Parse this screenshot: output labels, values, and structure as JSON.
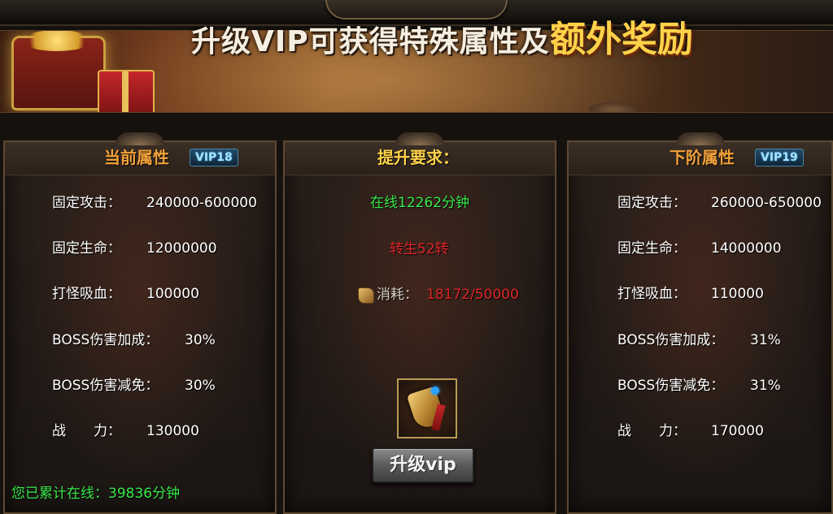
{
  "banner": {
    "title": "升级VIP可获得特殊属性及",
    "highlight": "额外奖励"
  },
  "current": {
    "title": "当前属性",
    "vip": "VIP18",
    "stats": [
      {
        "label": "固定攻击：",
        "value": "240000-600000"
      },
      {
        "label": "固定生命：",
        "value": "12000000"
      },
      {
        "label": "打怪吸血：",
        "value": "100000"
      },
      {
        "label": "BOSS伤害加成：",
        "value": "30%"
      },
      {
        "label": "BOSS伤害减免：",
        "value": "30%"
      },
      {
        "label": "战　　力：",
        "value": "130000"
      }
    ]
  },
  "requirement": {
    "title": "提升要求：",
    "online": "在线12262分钟",
    "rebirth": "转生52转",
    "cost_label": "消耗：",
    "cost_value": "18172/50000",
    "button": "升级vip"
  },
  "next": {
    "title": "下阶属性",
    "vip": "VIP19",
    "stats": [
      {
        "label": "固定攻击：",
        "value": "260000-650000"
      },
      {
        "label": "固定生命：",
        "value": "14000000"
      },
      {
        "label": "打怪吸血：",
        "value": "110000"
      },
      {
        "label": "BOSS伤害加成：",
        "value": "31%"
      },
      {
        "label": "BOSS伤害减免：",
        "value": "31%"
      },
      {
        "label": "战　　力：",
        "value": "170000"
      }
    ]
  },
  "footer": {
    "online_total": "您已累计在线：39836分钟"
  },
  "colors": {
    "title_orange": "#f3a23a",
    "green": "#39e84a",
    "red": "#e0262a",
    "gold": "#ffd24a"
  },
  "icons": {
    "cost": "scroll-icon",
    "item": "shield-emblem-icon"
  }
}
